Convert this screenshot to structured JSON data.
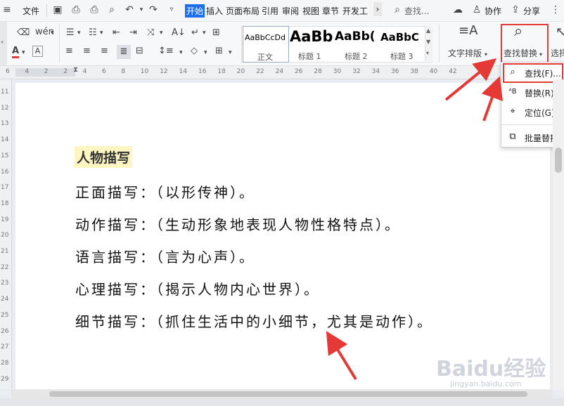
{
  "menubar": {
    "file_label": "文件",
    "tabs": [
      "开始",
      "插入",
      "页面布局",
      "引用",
      "审阅",
      "视图",
      "章节",
      "开发工"
    ],
    "more_label": "›",
    "search_placeholder": "查找...",
    "collab_label": "协作",
    "share_label": "分享"
  },
  "ribbon": {
    "styles": [
      {
        "sample": "AaBbCcDd",
        "label": "正文"
      },
      {
        "sample": "AaBb",
        "label": "标题 1"
      },
      {
        "sample": "AaBb(",
        "label": "标题 2"
      },
      {
        "sample": "AaBbC",
        "label": "标题 3"
      }
    ],
    "text_layout_label": "文字排版",
    "find_replace_label": "查找替换",
    "select_label": "选择"
  },
  "ruler": {
    "h_ticks": [
      "6",
      "4",
      "2",
      "2",
      "4",
      "6",
      "8",
      "10",
      "12",
      "14",
      "16",
      "18",
      "20",
      "22",
      "24",
      "26",
      "28",
      "30",
      "32",
      "34",
      "36",
      "38",
      "40",
      "42"
    ],
    "v_ticks": [
      "11",
      "12",
      "13",
      "14",
      "15",
      "16",
      "17",
      "18",
      "19",
      "20",
      "21",
      "22",
      "23",
      "24",
      "25",
      "26",
      "27",
      "28",
      "29"
    ]
  },
  "document": {
    "heading": "人物描写",
    "lines": [
      "正面描写：（以形传神）。",
      "动作描写：（生动形象地表现人物性格特点）。",
      "语言描写：（言为心声）。",
      "心理描写：（揭示人物内心世界）。",
      "细节描写：（抓住生活中的小细节，尤其是动作）。"
    ]
  },
  "dropdown": {
    "items": [
      {
        "label": "查找(F)...",
        "icon": "search-icon"
      },
      {
        "label": "替换(R)...",
        "icon": "replace-icon"
      },
      {
        "label": "定位(G)...",
        "icon": "locate-icon"
      },
      {
        "label": "批量替换",
        "icon": "batch-replace-icon"
      }
    ]
  },
  "watermark": {
    "text": "Baidu经验",
    "sub": "jingyan.baidu.com"
  },
  "colors": {
    "accent": "#1f6feb",
    "highlight_red": "#e53935",
    "heading_bg": "#fdf6c3"
  }
}
